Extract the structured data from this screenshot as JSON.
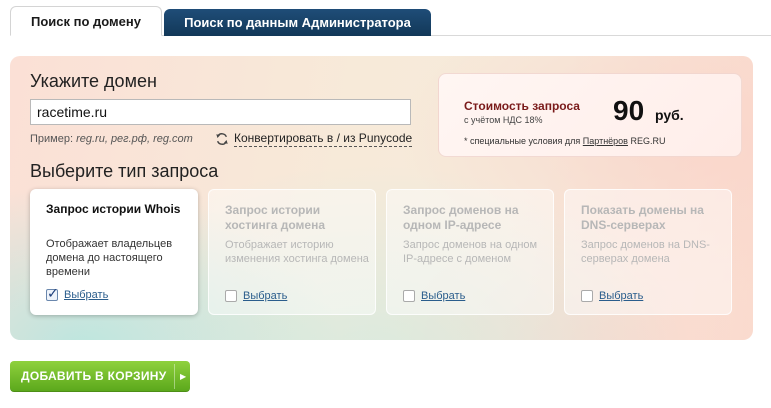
{
  "tabs": [
    {
      "label": "Поиск по домену",
      "active": true
    },
    {
      "label": "Поиск по данным Администратора",
      "active": false
    }
  ],
  "domain": {
    "title": "Укажите домен",
    "input_value": "racetime.ru",
    "example_label": "Пример:",
    "example_values": "reg.ru, рег.рф, reg.com",
    "convert_label": "Конвертировать в / из Punycode",
    "convert_icon": "refresh-icon"
  },
  "price": {
    "title": "Стоимость запроса",
    "vat": "с учётом НДС 18%",
    "amount": "90",
    "currency": "руб.",
    "note_prefix": "* специальные условия для",
    "note_link": "Партнёров",
    "note_suffix": "REG.RU"
  },
  "request_type": {
    "title": "Выберите тип запроса",
    "cards": [
      {
        "title": "Запрос истории Whois",
        "desc": "Отображает владельцев домена до настоящего времени",
        "select": "Выбрать",
        "checked": true
      },
      {
        "title": "Запрос истории хостинга домена",
        "desc": "Отображает историю изменения хостинга домена",
        "select": "Выбрать",
        "checked": false
      },
      {
        "title": "Запрос доменов на одном IP-адресе",
        "desc": "Запрос доменов на одном IP-адресе с доменом",
        "select": "Выбрать",
        "checked": false
      },
      {
        "title": "Показать домены на DNS-серверах",
        "desc": "Запрос доменов на DNS-серверах домена",
        "select": "Выбрать",
        "checked": false
      }
    ]
  },
  "cart_button": {
    "label": "ДОБАВИТЬ В КОРЗИНУ",
    "arrow_icon": "arrow-right-icon"
  },
  "colors": {
    "tab_dark": "#1f4d78",
    "price_title": "#7a1a1a",
    "button_green": "#6bb624",
    "link_blue": "#2a5d8c"
  }
}
